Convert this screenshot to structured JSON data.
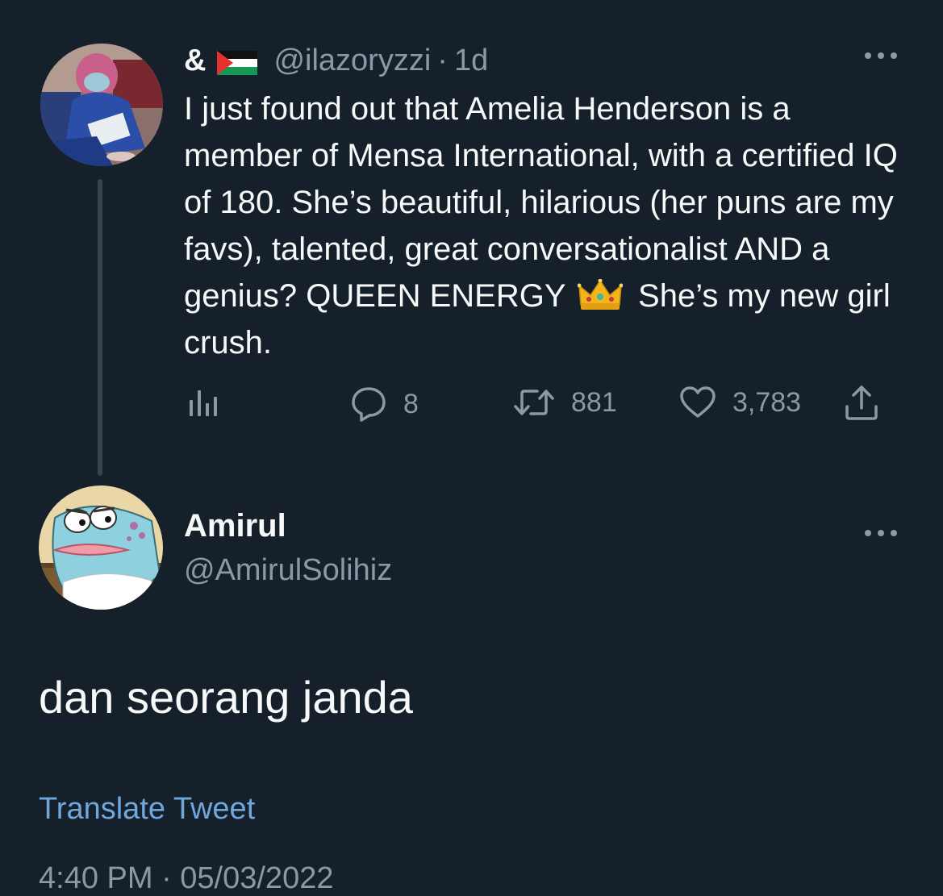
{
  "parent_tweet": {
    "display_name": "&",
    "flag_icon": "palestine-flag-icon",
    "handle": "@ilazoryzzi",
    "separator": "·",
    "time": "1d",
    "more_icon": "more-options-icon",
    "text_before_emoji": "I just found out that Amelia Henderson is a member of Mensa International, with a certified IQ of 180. She’s beautiful, hilarious (her puns are my favs), talented, great conversationalist AND a genius? QUEEN ENERGY",
    "emoji_icon": "crown-icon",
    "text_after_emoji": "She’s my new girl crush.",
    "actions": {
      "analytics_icon": "analytics-icon",
      "reply_icon": "reply-icon",
      "reply_count": "8",
      "retweet_icon": "retweet-icon",
      "retweet_count": "881",
      "like_icon": "heart-icon",
      "like_count": "3,783",
      "share_icon": "share-icon"
    }
  },
  "reply_tweet": {
    "display_name": "Amirul",
    "handle": "@AmirulSolihiz",
    "text": "dan seorang janda",
    "translate_label": "Translate Tweet",
    "timestamp": "4:40 PM · 05/03/2022"
  },
  "colors": {
    "background": "#15202b",
    "primary_text": "#f7f9f9",
    "secondary_text": "#8b98a5",
    "link": "#6fa8dc",
    "thread_line": "#38444d"
  }
}
